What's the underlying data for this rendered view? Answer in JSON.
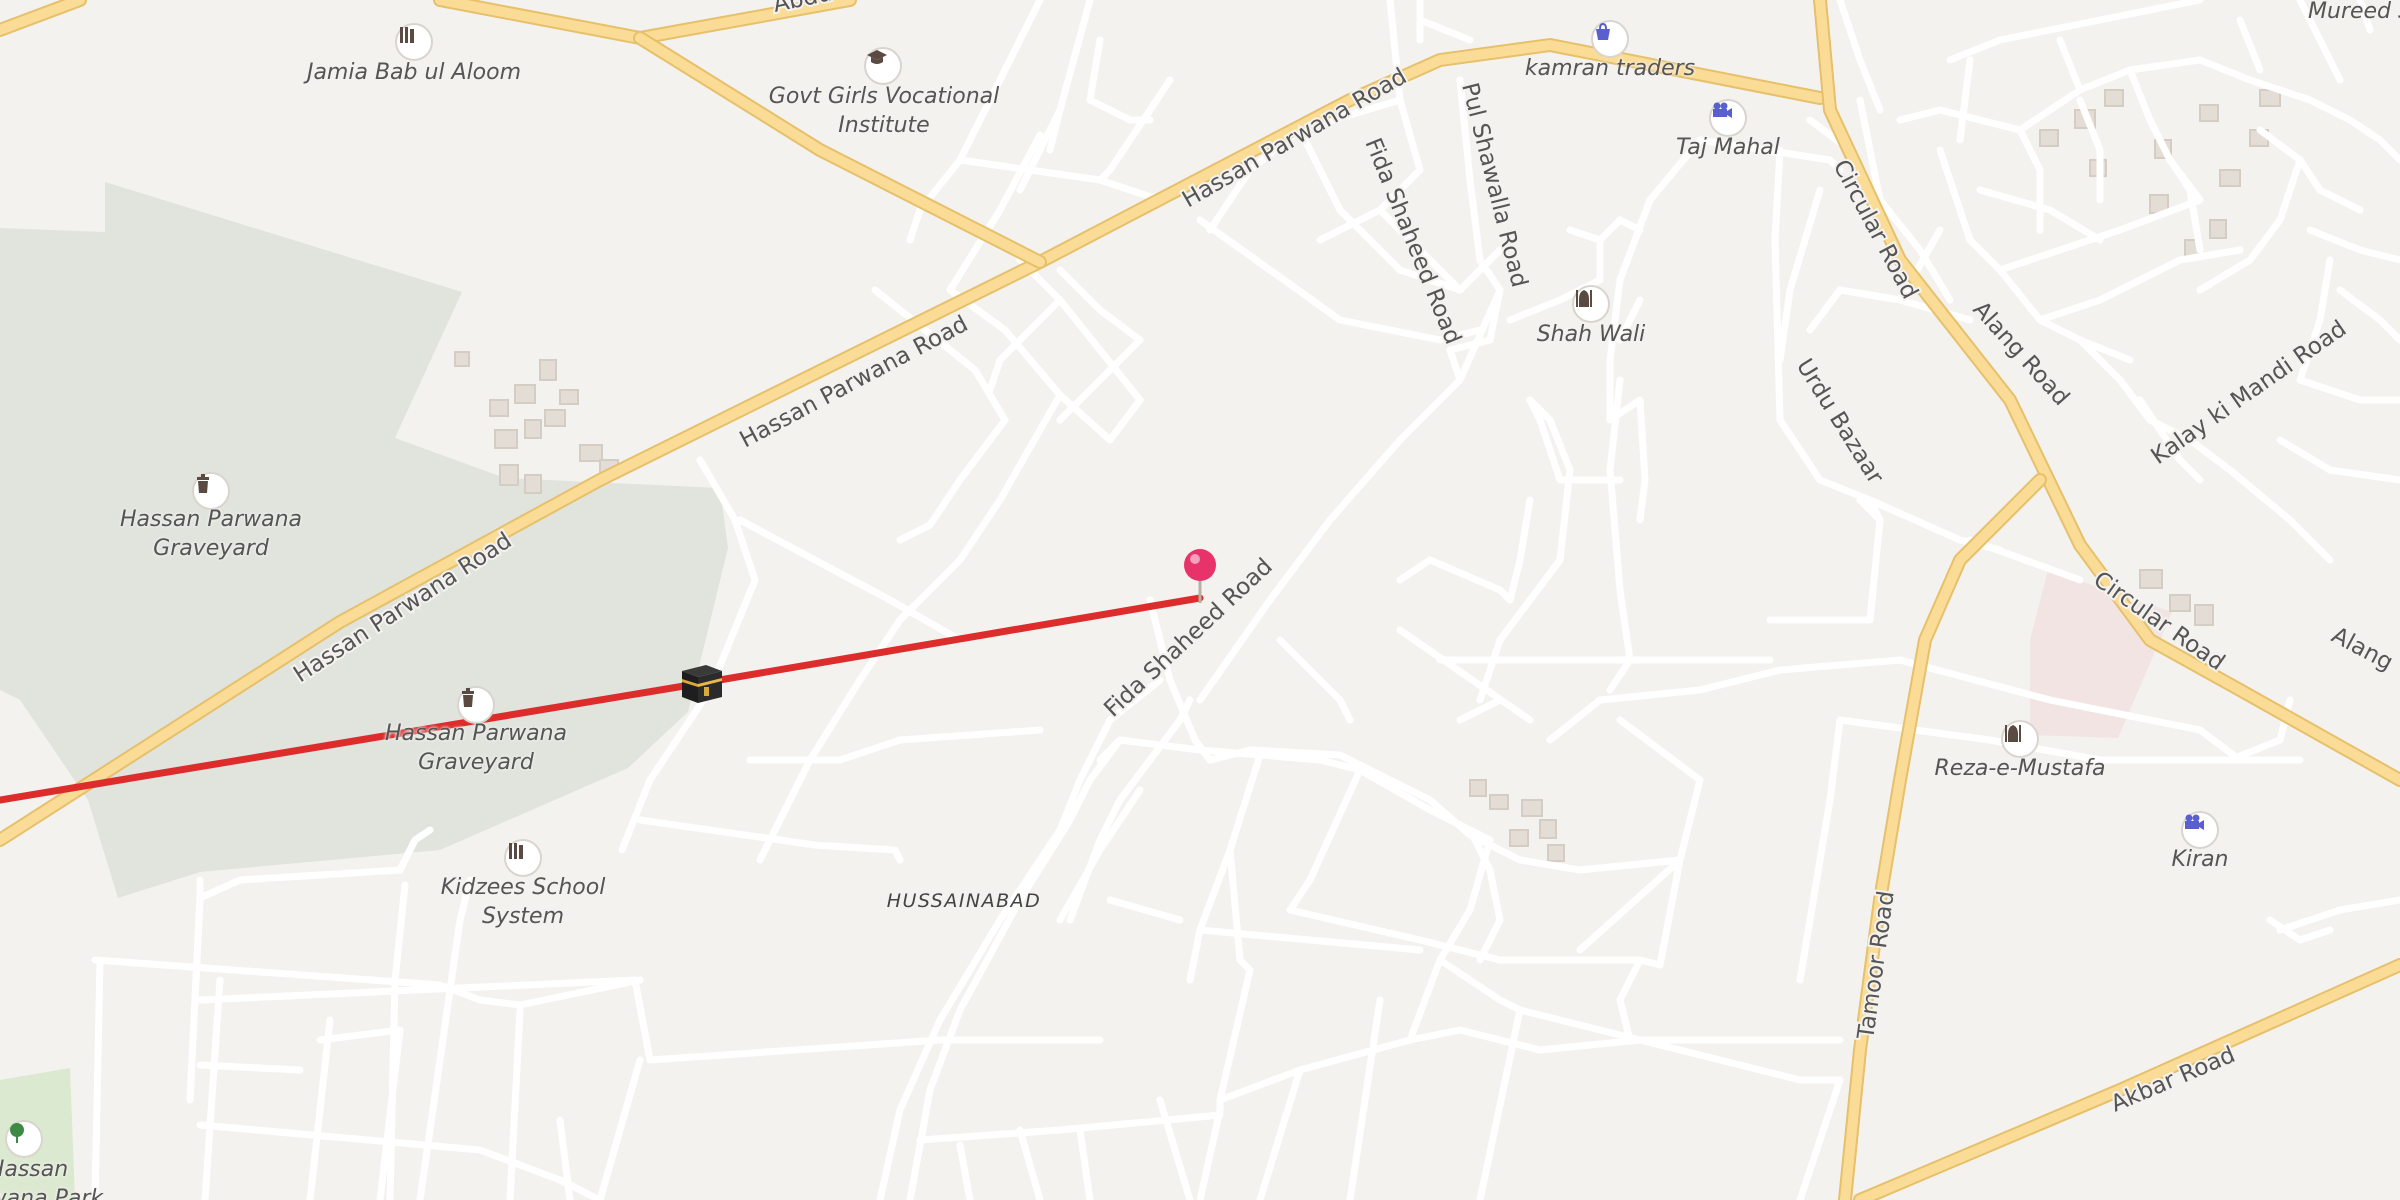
{
  "map": {
    "colors": {
      "background": "#f4f2ef",
      "park": "#e0e4dd",
      "minor_road": "#ffffff",
      "major_road": "#fbdc96",
      "route_line": "#dd2c2c",
      "pin": "#e8336a",
      "poi_icon": "#5a4a42",
      "poi_icon_blue": "#5a5fd0"
    },
    "roads": {
      "hassan_parwana_1": "Hassan Parwana Road",
      "hassan_parwana_2": "Hassan Parwana Road",
      "hassan_parwana_3": "Hassan Parwana Road",
      "fida_shaheed_1": "Fida Shaheed Road",
      "fida_shaheed_2": "Fida Shaheed Road",
      "pul_shawalla": "Pul Shawalla Road",
      "circular_1": "Circular Road",
      "circular_2": "Circular Road",
      "alang_1": "Alang Road",
      "alang_2": "Alang",
      "urdu_bazaar": "Urdu Bazaar",
      "kalay_ki_mandi": "Kalay ki Mandi Road",
      "tamoor": "Tamoor Road",
      "akbar": "Akbar Road",
      "abdu": "Abdu"
    },
    "places": {
      "jamia": "Jamia Bab ul Aloom",
      "govt_girls": "Govt Girls Vocational\nInstitute",
      "kamran": "kamran traders",
      "taj_mahal": "Taj Mahal",
      "shah_wali": "Shah Wali",
      "graveyard_1": "Hassan Parwana\nGraveyard",
      "graveyard_2": "Hassan Parwana\nGraveyard",
      "kidzees": "Kidzees School\nSystem",
      "hussainabad": "HUSSAINABAD",
      "reza": "Reza-e-Mustafa",
      "kiran": "Kiran",
      "mureed": "Mureed S",
      "hassan_park": "Hassan\nParwana Park"
    },
    "icons": {
      "jamia": "school-icon",
      "govt_girls": "graduation-cap-icon",
      "kamran": "shopping-bag-icon",
      "taj_mahal": "cinema-icon",
      "shah_wali": "mosque-icon",
      "graveyard_1": "cemetery-icon",
      "graveyard_2": "cemetery-icon",
      "kidzees": "school-icon",
      "reza": "mosque-icon",
      "kiran": "cinema-icon",
      "hassan_park": "tree-icon",
      "route_destination": "kaaba-icon",
      "location": "map-pin-icon"
    }
  }
}
